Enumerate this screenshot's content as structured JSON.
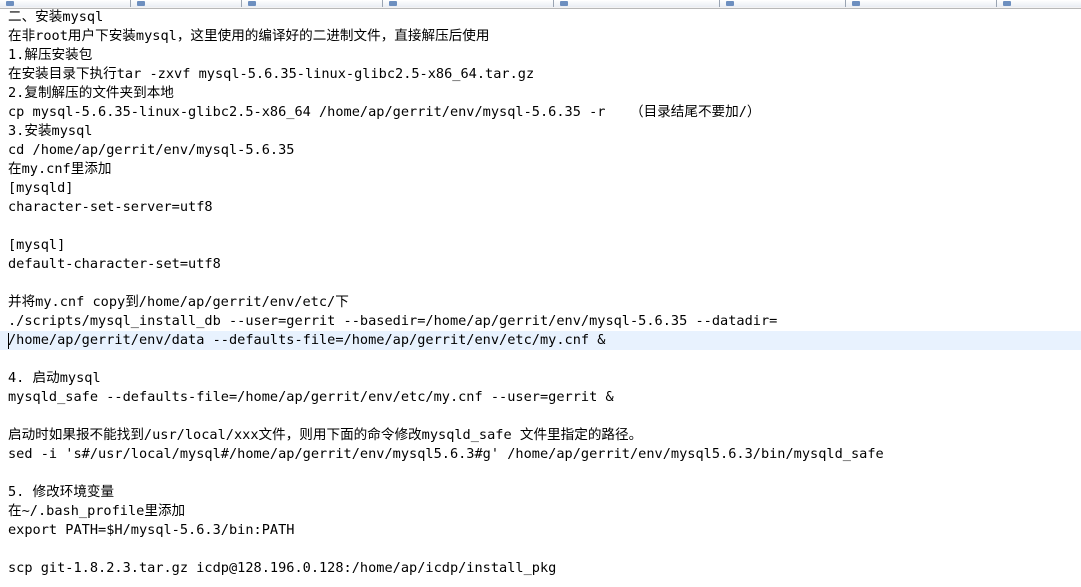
{
  "editor": {
    "current_line_index": 17,
    "colors": {
      "background": "#ffffff",
      "text": "#000000",
      "current_line": "#e8f2fe",
      "spellcheck_underline": "#d00000"
    }
  },
  "lines": [
    "二、安装mysql",
    "在非root用户下安装mysql，这里使用的编译好的二进制文件，直接解压后使用",
    "1.解压安装包",
    "在安装目录下执行tar -zxvf mysql-5.6.35-linux-glibc2.5-x86_64.tar.gz",
    "2.复制解压的文件夹到本地",
    "cp mysql-5.6.35-linux-glibc2.5-x86_64 /home/ap/gerrit/env/mysql-5.6.35 -r   （目录结尾不要加/）",
    "3.安装mysql",
    "cd /home/ap/gerrit/env/mysql-5.6.35",
    "在my.cnf里添加",
    "[mysqld]",
    "character-set-server=utf8",
    "",
    "[mysql]",
    "default-character-set=utf8",
    "",
    "并将my.cnf copy到/home/ap/gerrit/env/etc/下",
    "./scripts/mysql_install_db --user=gerrit --basedir=/home/ap/gerrit/env/mysql-5.6.35 --datadir=",
    "/home/ap/gerrit/env/data --defaults-file=/home/ap/gerrit/env/etc/my.cnf &",
    "",
    "4. 启动mysql",
    "mysqld_safe --defaults-file=/home/ap/gerrit/env/etc/my.cnf --user=gerrit &",
    "",
    "启动时如果报不能找到/usr/local/xxx文件，则用下面的命令修改mysqld_safe 文件里指定的路径。",
    "sed -i 's#/usr/local/mysql#/home/ap/gerrit/env/mysql5.6.3#g' /home/ap/gerrit/env/mysql5.6.3/bin/mysqld_safe",
    "",
    "5. 修改环境变量",
    "在~/.bash_profile里添加",
    "export PATH=$H/mysql-5.6.3/bin:PATH",
    "",
    "scp git-1.8.2.3.tar.gz icdp@128.196.0.128:/home/ap/icdp/install_pkg"
  ]
}
